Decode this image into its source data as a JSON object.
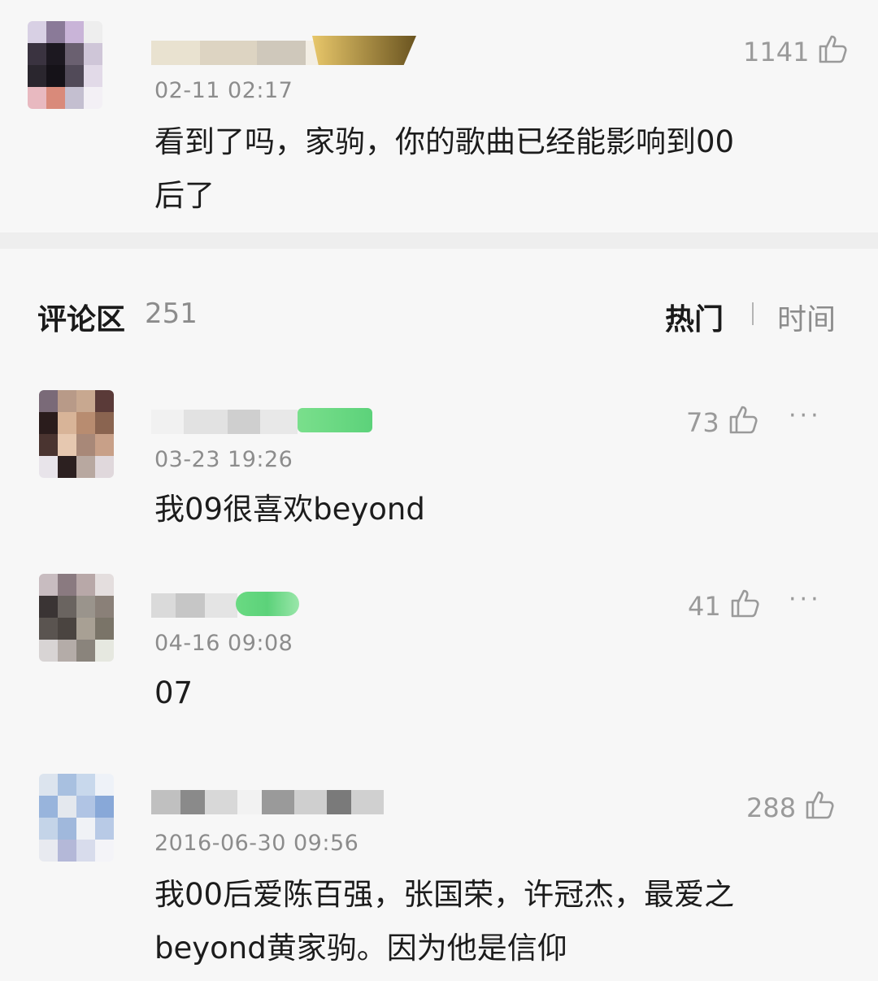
{
  "top_comment": {
    "time": "02-11 02:17",
    "likes": "1141",
    "text_line1": "看到了吗，家驹，你的歌曲已经能影响到00",
    "text_line2": "后了"
  },
  "section": {
    "title": "评论区",
    "count": "251",
    "sort_hot": "热门",
    "sort_time": "时间"
  },
  "comments": [
    {
      "time": "03-23 19:26",
      "likes": "73",
      "text": "我09很喜欢beyond",
      "more": "···"
    },
    {
      "time": "04-16 09:08",
      "likes": "41",
      "text": "07",
      "more": "···"
    },
    {
      "time": "2016-06-30 09:56",
      "likes": "288",
      "text_line1": "我00后爱陈百强，张国荣，许冠杰，最爱之",
      "text_line2": "beyond黄家驹。因为他是信仰"
    }
  ],
  "colors": {
    "vip_green": "#5cd27a",
    "text": "#1a1a1a",
    "muted": "#8c8c8c"
  },
  "icons": {
    "like": "thumbs-up-icon",
    "more": "more-icon"
  }
}
